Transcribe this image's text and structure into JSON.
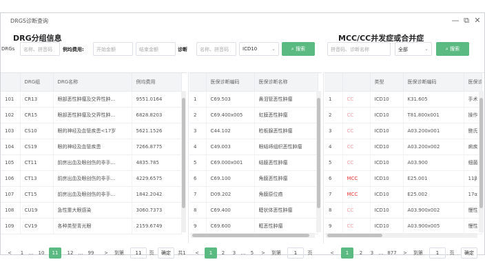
{
  "window": {
    "title": "DRGS诊断查询"
  },
  "left": {
    "section_title": "DRG分组信息",
    "drgs_label": "DRGs",
    "name_placeholder": "名称、拼音码",
    "cost_label": "例均费用:",
    "min_placeholder": "开始金额",
    "max_placeholder": "结束金额",
    "columns": [
      "",
      "DRG组",
      "DRG名称",
      "例均费用"
    ],
    "rows": [
      [
        "101",
        "CR13",
        "眼部恶性肿瘤及交界性肿...",
        "9551.0164"
      ],
      [
        "102",
        "CR15",
        "眼部恶性肿瘤及交界性肿...",
        "6828.8203"
      ],
      [
        "103",
        "CS10",
        "眼的神经及血管疾患<17岁",
        "5621.1526"
      ],
      [
        "104",
        "CS19",
        "眼的神经及血管疾患",
        "7266.8775"
      ],
      [
        "105",
        "CT11",
        "前房出血及眼创伤的非手...",
        "4835.785"
      ],
      [
        "106",
        "CT13",
        "前房出血及眼创伤的非手...",
        "4229.6575"
      ],
      [
        "107",
        "CT15",
        "前房出血及眼创伤的非手...",
        "1842.2042"
      ],
      [
        "108",
        "CU19",
        "急性重大眼感染",
        "3060.7373"
      ],
      [
        "109",
        "CV19",
        "各种类型青光眼",
        "2159.6749"
      ]
    ],
    "pager": {
      "prev": "<",
      "first": "1",
      "ellipsis1": "...",
      "p10": "10",
      "current": "11",
      "p12": "12",
      "ellipsis2": "...",
      "last": "99",
      "next": ">",
      "goto": "到第",
      "page_value": "11",
      "page_unit": "页",
      "confirm": "确定",
      "total": "共1"
    }
  },
  "middle": {
    "diag_label": "诊断",
    "diag_placeholder": "名称、拼音码",
    "code_type": "ICD10",
    "search_label": "搜索",
    "columns": [
      "",
      "医保诊断编码",
      "医保诊断名称"
    ],
    "rows": [
      [
        "1",
        "C69.503",
        "鼻泪管恶性肿瘤"
      ],
      [
        "2",
        "C69.400x005",
        "虹膜恶性肿瘤"
      ],
      [
        "3",
        "C44.102",
        "睑板腺恶性肿瘤"
      ],
      [
        "4",
        "C49.003",
        "眼结缔组织恶性肿瘤"
      ],
      [
        "5",
        "C69.000x001",
        "结膜恶性肿瘤"
      ],
      [
        "6",
        "C69.100",
        "角膜恶性肿瘤"
      ],
      [
        "7",
        "D09.202",
        "角膜原位癌"
      ],
      [
        "8",
        "C69.400",
        "睫状体恶性肿瘤"
      ],
      [
        "9",
        "C69.600",
        "眶恶性肿瘤"
      ]
    ],
    "pager": {
      "prev": "<",
      "current": "1",
      "p2": "2",
      "p3": "3",
      "ellipsis": "...",
      "last": "5",
      "next": ">",
      "goto": "到第",
      "page_value": "1",
      "page_unit": "页"
    }
  },
  "right": {
    "section_title": "MCC/CC并发症或合并症",
    "name_placeholder": "拼音码、诊断名称",
    "filter": "全部",
    "search_label": "搜索",
    "columns": [
      "",
      "",
      "类型",
      "医保诊断编码",
      "医保诊"
    ],
    "rows": [
      [
        "1",
        "CC",
        "ICD10",
        "K31.605",
        "手术"
      ],
      [
        "2",
        "CC",
        "ICD10",
        "T81.800x001",
        "操作"
      ],
      [
        "3",
        "CC",
        "ICD10",
        "A03.200x001",
        "鲍氏"
      ],
      [
        "4",
        "CC",
        "ICD10",
        "A03.200x002",
        "痢疾"
      ],
      [
        "5",
        "CC",
        "ICD10",
        "A03.900",
        "细菌"
      ],
      [
        "6",
        "MCC",
        "ICD10",
        "E25.001",
        "11β"
      ],
      [
        "7",
        "MCC",
        "ICD10",
        "E25.002",
        "17α"
      ],
      [
        "8",
        "CC",
        "ICD10",
        "A03.900x002",
        "慢性"
      ],
      [
        "9",
        "CC",
        "ICD10",
        "A03.900x005",
        "慢性"
      ]
    ],
    "pager": {
      "prev": "<",
      "current": "1",
      "p2": "2",
      "p3": "3",
      "ellipsis": "...",
      "last": "877",
      "next": ">",
      "goto": "到第",
      "page_value": "1",
      "page_unit": "页",
      "confirm": "确定"
    }
  },
  "colors": {
    "accent": "#5bb982",
    "mcc": "#e33333",
    "cc": "#f0a0a0"
  }
}
